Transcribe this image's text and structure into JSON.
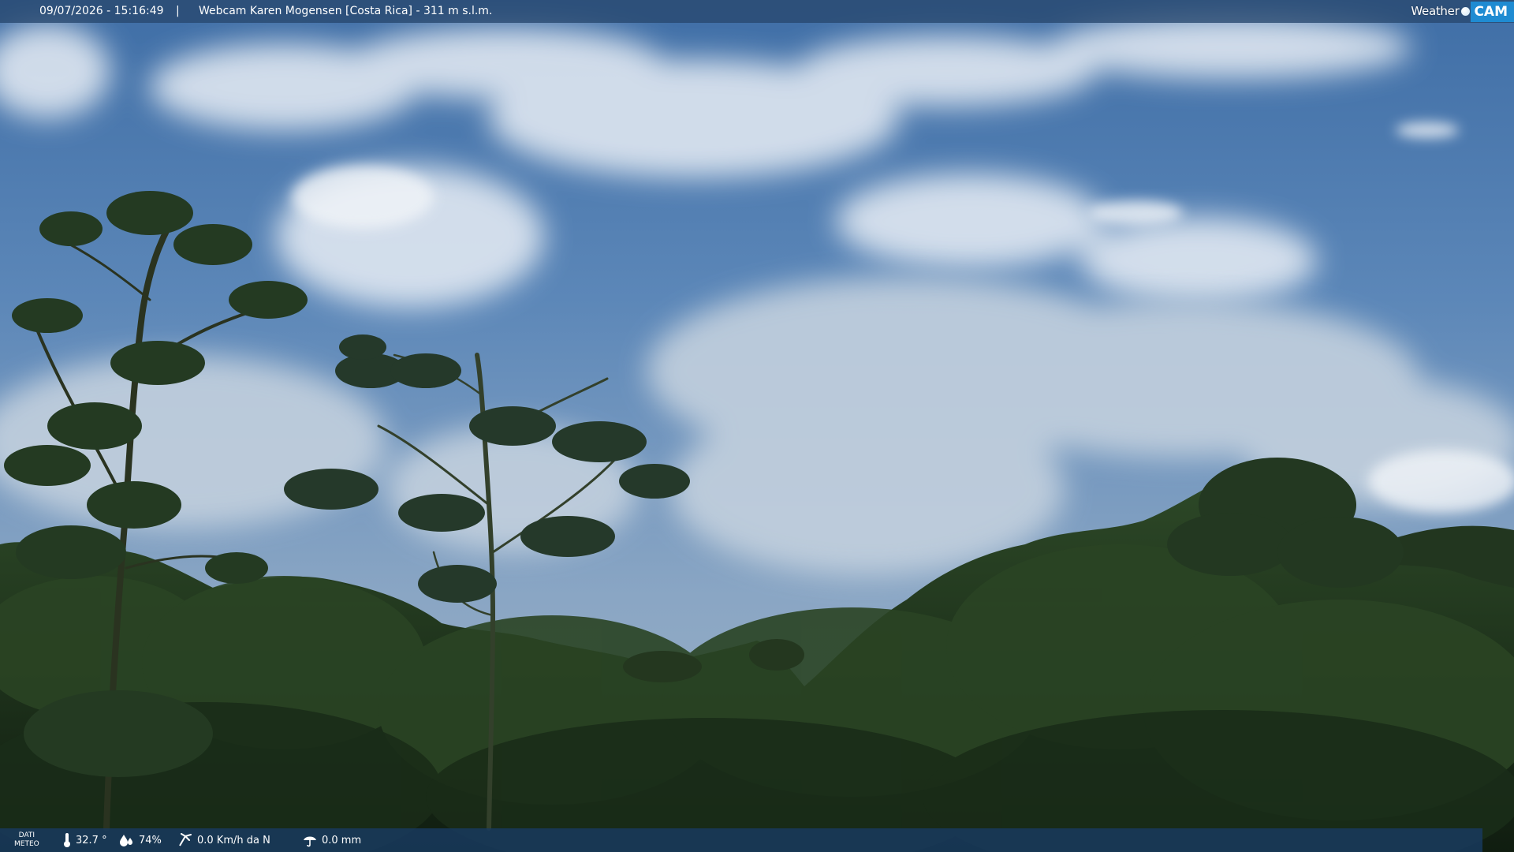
{
  "header": {
    "timestamp": "09/07/2026 - 15:16:49",
    "separator": "|",
    "title": "Webcam Karen Mogensen [Costa Rica] - 311 m s.l.m.",
    "brand_word": "Weather",
    "brand_cam": "CAM"
  },
  "footer": {
    "label_line1": "DATI",
    "label_line2": "METEO",
    "temperature": "32.7 °",
    "humidity": "74%",
    "wind": "0.0 Km/h da N",
    "rain": "0.0 mm"
  },
  "icons": {
    "temperature": "thermometer-icon",
    "humidity": "humidity-drop-icon",
    "wind": "wind-icon",
    "rain": "rain-icon"
  },
  "colors": {
    "brand_blue": "#1f8bd2",
    "top_bar": "#28486e",
    "bottom_bar": "#183a60"
  }
}
